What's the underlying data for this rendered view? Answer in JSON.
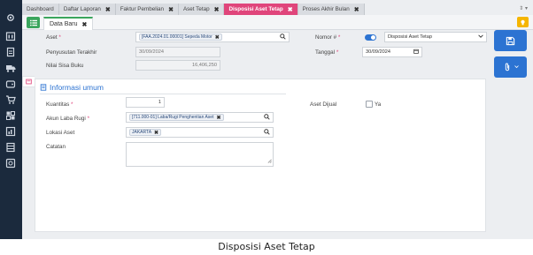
{
  "tabs": [
    {
      "label": "Dashboard",
      "closable": false
    },
    {
      "label": "Daftar Laporan",
      "closable": true
    },
    {
      "label": "Faktur Pembelian",
      "closable": true
    },
    {
      "label": "Aset Tetap",
      "closable": true
    },
    {
      "label": "Disposisi Aset Tetap",
      "closable": true,
      "active": true
    },
    {
      "label": "Proses Akhir Bulan",
      "closable": true
    }
  ],
  "tab_close_glyph": "✖",
  "tab_menu_glyph": "⇕ ▾",
  "doc_tab": {
    "label": "Data Baru",
    "close": "✖"
  },
  "form": {
    "aset": {
      "label": "Aset",
      "value": "[FAA.2024.01.00001] Sepeda Motor",
      "remove": "✖"
    },
    "penyusutan": {
      "label": "Penyusutan Terakhir",
      "value": "30/09/2024"
    },
    "nilai_sisa": {
      "label": "Nilai Sisa Buku",
      "value": "16,406,250"
    },
    "nomor": {
      "label": "Nomor #",
      "value": "Disposisi Aset Tetap"
    },
    "tanggal": {
      "label": "Tanggal",
      "value": "30/09/2024"
    }
  },
  "section": {
    "title": "Informasi umum",
    "kuantitas": {
      "label": "Kuantitas",
      "value": "1"
    },
    "akun": {
      "label": "Akun Laba Rugi",
      "value": "[711.000-01] Laba/Rugi Penghentian Aset",
      "remove": "✖"
    },
    "lokasi": {
      "label": "Lokasi Aset",
      "value": "JAKARTA",
      "remove": "✖"
    },
    "catatan": {
      "label": "Catatan",
      "value": ""
    },
    "dijual": {
      "label": "Aset Dijual",
      "checkbox_label": "Ya"
    }
  },
  "required_mark": "*",
  "caption": "Disposisi Aset Tetap",
  "colors": {
    "sidebar": "#1b2a3d",
    "active_tab": "#e0457b",
    "primary": "#2c73d2",
    "green": "#3aa55d",
    "bulb": "#f5b500"
  }
}
